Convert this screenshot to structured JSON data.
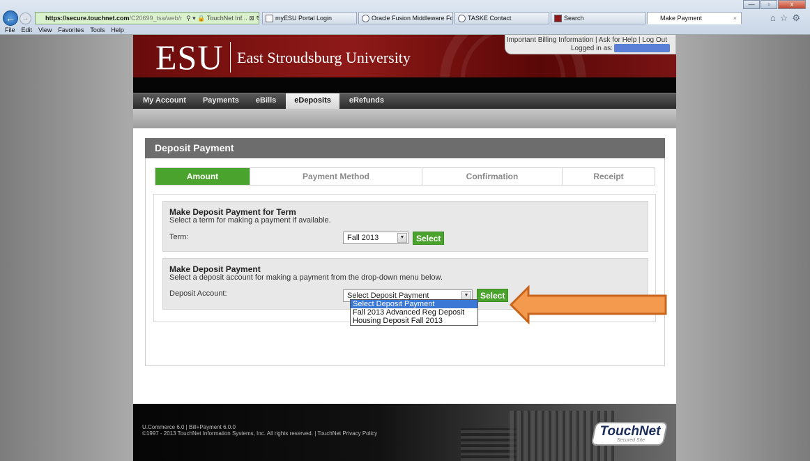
{
  "browser": {
    "address": {
      "host": "https://secure.touchnet.com",
      "path": "/C20699_tsa/web/r",
      "tools": "⚲ ▾ 🔒 TouchNet Inf... ⊠ ↻ ✕"
    },
    "tabs": [
      {
        "label": "myESU Portal Login"
      },
      {
        "label": "Oracle Fusion Middleware For..."
      },
      {
        "label": "TASKE Contact"
      },
      {
        "label": "Search"
      },
      {
        "label": "Make Payment"
      }
    ],
    "tab_close": "×",
    "menu": [
      "File",
      "Edit",
      "View",
      "Favorites",
      "Tools",
      "Help"
    ],
    "window_buttons": [
      "—",
      "▫",
      "x"
    ]
  },
  "header": {
    "logo_abbr": "ESU",
    "logo_name": "East Stroudsburg University",
    "top_links": "Important Billing Information | Ask for Help | Log Out",
    "logged_in": "Logged in as:"
  },
  "nav": {
    "items": [
      {
        "label": "My Account"
      },
      {
        "label": "Payments"
      },
      {
        "label": "eBills"
      },
      {
        "label": "eDeposits"
      },
      {
        "label": "eRefunds"
      }
    ],
    "active": "eDeposits"
  },
  "panel": {
    "title": "Deposit Payment",
    "steps": [
      {
        "label": "Amount"
      },
      {
        "label": "Payment Method"
      },
      {
        "label": "Confirmation"
      },
      {
        "label": "Receipt"
      }
    ],
    "active_step": "Amount",
    "term_section": {
      "title": "Make Deposit Payment for Term",
      "desc": "Select a term for making a payment if available.",
      "label": "Term:",
      "value": "Fall 2013",
      "button": "Select"
    },
    "deposit_section": {
      "title": "Make Deposit Payment",
      "desc": "Select a deposit account for making a payment from the drop-down menu below.",
      "label": "Deposit Account:",
      "value": "Select Deposit Payment",
      "button": "Select",
      "options": [
        {
          "label": "Select Deposit Payment",
          "selected": true
        },
        {
          "label": "Fall 2013 Advanced Reg Deposit",
          "selected": false
        },
        {
          "label": "Housing Deposit Fall 2013",
          "selected": false
        }
      ]
    }
  },
  "footer": {
    "line1": "U.Commerce 6.0 | Bill+Payment 6.0.0",
    "line2": "©1997 - 2013 TouchNet Information Systems, Inc. All rights reserved. | TouchNet Privacy Policy",
    "logo": "TouchNet",
    "logo_sub": "Secured Site"
  },
  "colors": {
    "accent_green": "#4aa32c",
    "banner_red": "#8e1a18",
    "annotation_orange": "#f39a4e"
  }
}
